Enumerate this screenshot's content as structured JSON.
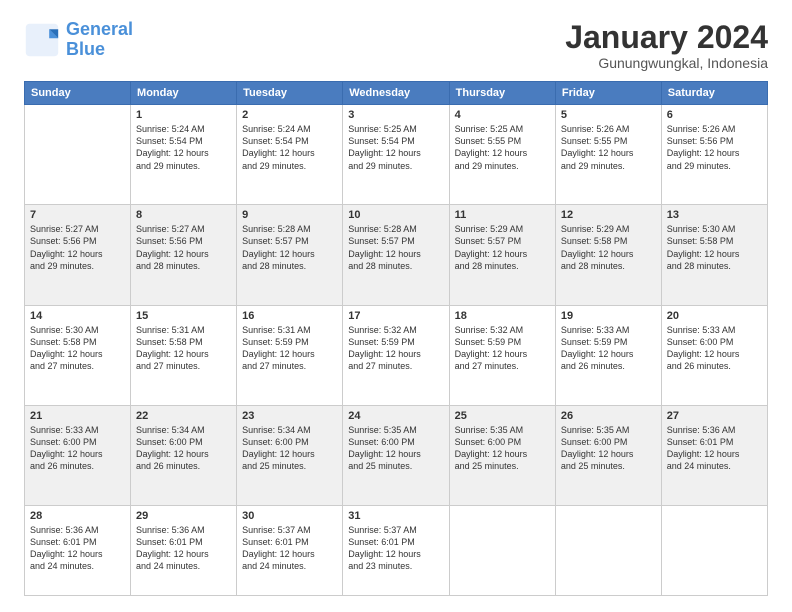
{
  "logo": {
    "line1": "General",
    "line2": "Blue"
  },
  "title": "January 2024",
  "subtitle": "Gunungwungkal, Indonesia",
  "weekdays": [
    "Sunday",
    "Monday",
    "Tuesday",
    "Wednesday",
    "Thursday",
    "Friday",
    "Saturday"
  ],
  "weeks": [
    [
      {
        "day": "",
        "info": ""
      },
      {
        "day": "1",
        "info": "Sunrise: 5:24 AM\nSunset: 5:54 PM\nDaylight: 12 hours\nand 29 minutes."
      },
      {
        "day": "2",
        "info": "Sunrise: 5:24 AM\nSunset: 5:54 PM\nDaylight: 12 hours\nand 29 minutes."
      },
      {
        "day": "3",
        "info": "Sunrise: 5:25 AM\nSunset: 5:54 PM\nDaylight: 12 hours\nand 29 minutes."
      },
      {
        "day": "4",
        "info": "Sunrise: 5:25 AM\nSunset: 5:55 PM\nDaylight: 12 hours\nand 29 minutes."
      },
      {
        "day": "5",
        "info": "Sunrise: 5:26 AM\nSunset: 5:55 PM\nDaylight: 12 hours\nand 29 minutes."
      },
      {
        "day": "6",
        "info": "Sunrise: 5:26 AM\nSunset: 5:56 PM\nDaylight: 12 hours\nand 29 minutes."
      }
    ],
    [
      {
        "day": "7",
        "info": "Sunrise: 5:27 AM\nSunset: 5:56 PM\nDaylight: 12 hours\nand 29 minutes."
      },
      {
        "day": "8",
        "info": "Sunrise: 5:27 AM\nSunset: 5:56 PM\nDaylight: 12 hours\nand 28 minutes."
      },
      {
        "day": "9",
        "info": "Sunrise: 5:28 AM\nSunset: 5:57 PM\nDaylight: 12 hours\nand 28 minutes."
      },
      {
        "day": "10",
        "info": "Sunrise: 5:28 AM\nSunset: 5:57 PM\nDaylight: 12 hours\nand 28 minutes."
      },
      {
        "day": "11",
        "info": "Sunrise: 5:29 AM\nSunset: 5:57 PM\nDaylight: 12 hours\nand 28 minutes."
      },
      {
        "day": "12",
        "info": "Sunrise: 5:29 AM\nSunset: 5:58 PM\nDaylight: 12 hours\nand 28 minutes."
      },
      {
        "day": "13",
        "info": "Sunrise: 5:30 AM\nSunset: 5:58 PM\nDaylight: 12 hours\nand 28 minutes."
      }
    ],
    [
      {
        "day": "14",
        "info": "Sunrise: 5:30 AM\nSunset: 5:58 PM\nDaylight: 12 hours\nand 27 minutes."
      },
      {
        "day": "15",
        "info": "Sunrise: 5:31 AM\nSunset: 5:58 PM\nDaylight: 12 hours\nand 27 minutes."
      },
      {
        "day": "16",
        "info": "Sunrise: 5:31 AM\nSunset: 5:59 PM\nDaylight: 12 hours\nand 27 minutes."
      },
      {
        "day": "17",
        "info": "Sunrise: 5:32 AM\nSunset: 5:59 PM\nDaylight: 12 hours\nand 27 minutes."
      },
      {
        "day": "18",
        "info": "Sunrise: 5:32 AM\nSunset: 5:59 PM\nDaylight: 12 hours\nand 27 minutes."
      },
      {
        "day": "19",
        "info": "Sunrise: 5:33 AM\nSunset: 5:59 PM\nDaylight: 12 hours\nand 26 minutes."
      },
      {
        "day": "20",
        "info": "Sunrise: 5:33 AM\nSunset: 6:00 PM\nDaylight: 12 hours\nand 26 minutes."
      }
    ],
    [
      {
        "day": "21",
        "info": "Sunrise: 5:33 AM\nSunset: 6:00 PM\nDaylight: 12 hours\nand 26 minutes."
      },
      {
        "day": "22",
        "info": "Sunrise: 5:34 AM\nSunset: 6:00 PM\nDaylight: 12 hours\nand 26 minutes."
      },
      {
        "day": "23",
        "info": "Sunrise: 5:34 AM\nSunset: 6:00 PM\nDaylight: 12 hours\nand 25 minutes."
      },
      {
        "day": "24",
        "info": "Sunrise: 5:35 AM\nSunset: 6:00 PM\nDaylight: 12 hours\nand 25 minutes."
      },
      {
        "day": "25",
        "info": "Sunrise: 5:35 AM\nSunset: 6:00 PM\nDaylight: 12 hours\nand 25 minutes."
      },
      {
        "day": "26",
        "info": "Sunrise: 5:35 AM\nSunset: 6:00 PM\nDaylight: 12 hours\nand 25 minutes."
      },
      {
        "day": "27",
        "info": "Sunrise: 5:36 AM\nSunset: 6:01 PM\nDaylight: 12 hours\nand 24 minutes."
      }
    ],
    [
      {
        "day": "28",
        "info": "Sunrise: 5:36 AM\nSunset: 6:01 PM\nDaylight: 12 hours\nand 24 minutes."
      },
      {
        "day": "29",
        "info": "Sunrise: 5:36 AM\nSunset: 6:01 PM\nDaylight: 12 hours\nand 24 minutes."
      },
      {
        "day": "30",
        "info": "Sunrise: 5:37 AM\nSunset: 6:01 PM\nDaylight: 12 hours\nand 24 minutes."
      },
      {
        "day": "31",
        "info": "Sunrise: 5:37 AM\nSunset: 6:01 PM\nDaylight: 12 hours\nand 23 minutes."
      },
      {
        "day": "",
        "info": ""
      },
      {
        "day": "",
        "info": ""
      },
      {
        "day": "",
        "info": ""
      }
    ]
  ]
}
